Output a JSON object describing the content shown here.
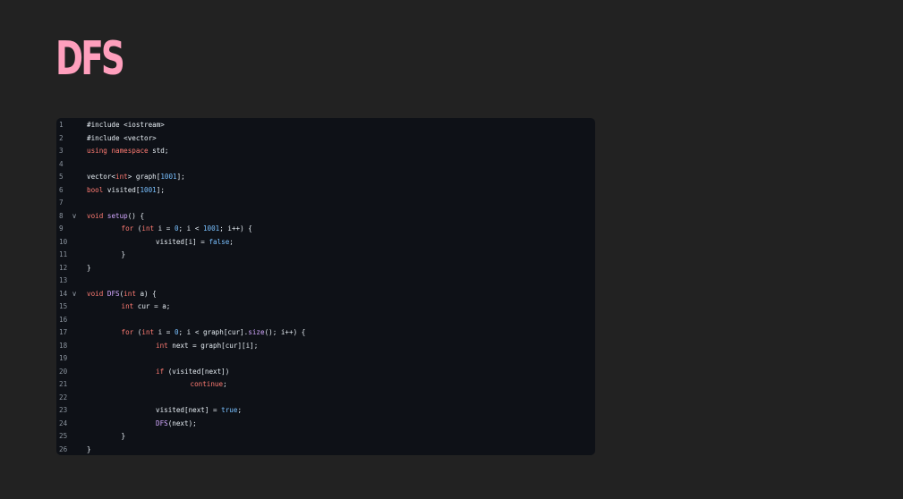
{
  "page": {
    "title": "DFS"
  },
  "colors": {
    "background": "#222222",
    "title": "#ff9fbd",
    "code_background": "#0e1117",
    "line_number": "#8b949e",
    "plain_text": "#e6edf3",
    "keyword": "#ff7b72",
    "number": "#79c0ff",
    "function": "#d2a8ff"
  },
  "code_block": {
    "language": "cpp",
    "lines": [
      {
        "number": "1",
        "foldable": false,
        "indent": 0,
        "tokens": [
          {
            "text": "#include <iostream>",
            "kind": "plain"
          }
        ]
      },
      {
        "number": "2",
        "foldable": false,
        "indent": 0,
        "tokens": [
          {
            "text": "#include <vector>",
            "kind": "plain"
          }
        ]
      },
      {
        "number": "3",
        "foldable": false,
        "indent": 0,
        "tokens": [
          {
            "text": "using",
            "kind": "keyword"
          },
          {
            "text": " ",
            "kind": "plain"
          },
          {
            "text": "namespace",
            "kind": "keyword"
          },
          {
            "text": " std;",
            "kind": "plain"
          }
        ]
      },
      {
        "number": "4",
        "foldable": false,
        "indent": 0,
        "tokens": []
      },
      {
        "number": "5",
        "foldable": false,
        "indent": 0,
        "tokens": [
          {
            "text": "vector<",
            "kind": "plain"
          },
          {
            "text": "int",
            "kind": "keyword"
          },
          {
            "text": "> graph[",
            "kind": "plain"
          },
          {
            "text": "1001",
            "kind": "number"
          },
          {
            "text": "];",
            "kind": "plain"
          }
        ]
      },
      {
        "number": "6",
        "foldable": false,
        "indent": 0,
        "tokens": [
          {
            "text": "bool",
            "kind": "keyword"
          },
          {
            "text": " visited[",
            "kind": "plain"
          },
          {
            "text": "1001",
            "kind": "number"
          },
          {
            "text": "];",
            "kind": "plain"
          }
        ]
      },
      {
        "number": "7",
        "foldable": false,
        "indent": 0,
        "tokens": []
      },
      {
        "number": "8",
        "foldable": true,
        "indent": 0,
        "tokens": [
          {
            "text": "void",
            "kind": "keyword"
          },
          {
            "text": " ",
            "kind": "plain"
          },
          {
            "text": "setup",
            "kind": "func"
          },
          {
            "text": "() {",
            "kind": "plain"
          }
        ]
      },
      {
        "number": "9",
        "foldable": false,
        "indent": 1,
        "tokens": [
          {
            "text": "for",
            "kind": "keyword"
          },
          {
            "text": " (",
            "kind": "plain"
          },
          {
            "text": "int",
            "kind": "keyword"
          },
          {
            "text": " i = ",
            "kind": "plain"
          },
          {
            "text": "0",
            "kind": "number"
          },
          {
            "text": "; i < ",
            "kind": "plain"
          },
          {
            "text": "1001",
            "kind": "number"
          },
          {
            "text": "; i++) {",
            "kind": "plain"
          }
        ]
      },
      {
        "number": "10",
        "foldable": false,
        "indent": 2,
        "tokens": [
          {
            "text": "visited[i] = ",
            "kind": "plain"
          },
          {
            "text": "false",
            "kind": "number"
          },
          {
            "text": ";",
            "kind": "plain"
          }
        ]
      },
      {
        "number": "11",
        "foldable": false,
        "indent": 1,
        "tokens": [
          {
            "text": "}",
            "kind": "plain"
          }
        ]
      },
      {
        "number": "12",
        "foldable": false,
        "indent": 0,
        "tokens": [
          {
            "text": "}",
            "kind": "plain"
          }
        ]
      },
      {
        "number": "13",
        "foldable": false,
        "indent": 0,
        "tokens": []
      },
      {
        "number": "14",
        "foldable": true,
        "indent": 0,
        "tokens": [
          {
            "text": "void",
            "kind": "keyword"
          },
          {
            "text": " ",
            "kind": "plain"
          },
          {
            "text": "DFS",
            "kind": "func"
          },
          {
            "text": "(",
            "kind": "plain"
          },
          {
            "text": "int",
            "kind": "keyword"
          },
          {
            "text": " a) {",
            "kind": "plain"
          }
        ]
      },
      {
        "number": "15",
        "foldable": false,
        "indent": 1,
        "tokens": [
          {
            "text": "int",
            "kind": "keyword"
          },
          {
            "text": " cur = a;",
            "kind": "plain"
          }
        ]
      },
      {
        "number": "16",
        "foldable": false,
        "indent": 0,
        "tokens": []
      },
      {
        "number": "17",
        "foldable": false,
        "indent": 1,
        "tokens": [
          {
            "text": "for",
            "kind": "keyword"
          },
          {
            "text": " (",
            "kind": "plain"
          },
          {
            "text": "int",
            "kind": "keyword"
          },
          {
            "text": " i = ",
            "kind": "plain"
          },
          {
            "text": "0",
            "kind": "number"
          },
          {
            "text": "; i < graph[cur].",
            "kind": "plain"
          },
          {
            "text": "size",
            "kind": "func"
          },
          {
            "text": "(); i++) {",
            "kind": "plain"
          }
        ]
      },
      {
        "number": "18",
        "foldable": false,
        "indent": 2,
        "tokens": [
          {
            "text": "int",
            "kind": "keyword"
          },
          {
            "text": " next = graph[cur][i];",
            "kind": "plain"
          }
        ]
      },
      {
        "number": "19",
        "foldable": false,
        "indent": 0,
        "tokens": []
      },
      {
        "number": "20",
        "foldable": false,
        "indent": 2,
        "tokens": [
          {
            "text": "if",
            "kind": "keyword"
          },
          {
            "text": " (visited[next])",
            "kind": "plain"
          }
        ]
      },
      {
        "number": "21",
        "foldable": false,
        "indent": 3,
        "tokens": [
          {
            "text": "continue",
            "kind": "keyword"
          },
          {
            "text": ";",
            "kind": "plain"
          }
        ]
      },
      {
        "number": "22",
        "foldable": false,
        "indent": 0,
        "tokens": []
      },
      {
        "number": "23",
        "foldable": false,
        "indent": 2,
        "tokens": [
          {
            "text": "visited[next] = ",
            "kind": "plain"
          },
          {
            "text": "true",
            "kind": "number"
          },
          {
            "text": ";",
            "kind": "plain"
          }
        ]
      },
      {
        "number": "24",
        "foldable": false,
        "indent": 2,
        "tokens": [
          {
            "text": "DFS",
            "kind": "func"
          },
          {
            "text": "(next);",
            "kind": "plain"
          }
        ]
      },
      {
        "number": "25",
        "foldable": false,
        "indent": 1,
        "tokens": [
          {
            "text": "}",
            "kind": "plain"
          }
        ]
      },
      {
        "number": "26",
        "foldable": false,
        "indent": 0,
        "tokens": [
          {
            "text": "}",
            "kind": "plain"
          }
        ]
      }
    ]
  }
}
